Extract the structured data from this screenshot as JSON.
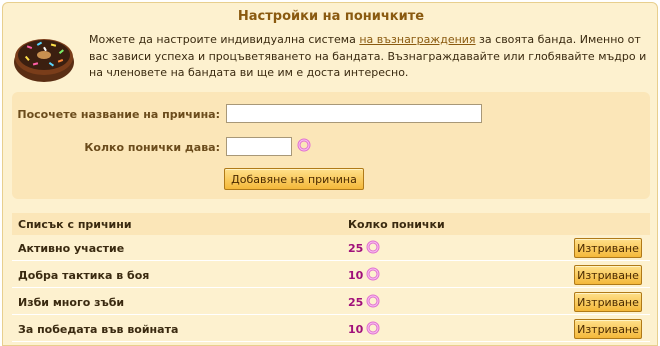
{
  "panel": {
    "title": "Настройки на поничките",
    "intro_before": "Можете да настроите индивидуална система ",
    "intro_link": "на възнаграждения",
    "intro_after": " за своята банда. Именно от вас зависи успеха и процъветяването на бандата. Възнаграждавайте или глобявайте мъдро и на членовете на бандата ви ще им е доста интересно."
  },
  "form": {
    "reason_label": "Посочете название на причина:",
    "reason_value": "",
    "donuts_label": "Колко понички дава:",
    "donuts_value": "",
    "add_button": "Добавяне на причина"
  },
  "table": {
    "col_reason": "Списък с причини",
    "col_donuts": "Колко понички",
    "delete_label": "Изтриване",
    "rows": [
      {
        "name": "Активно участие",
        "count": "25"
      },
      {
        "name": "Добра тактика в боя",
        "count": "10"
      },
      {
        "name": "Изби много зъби",
        "count": "25"
      },
      {
        "name": "За победата във войната",
        "count": "10"
      }
    ]
  },
  "colors": {
    "panel_bg": "#fdf1cf",
    "form_bg": "#fbe6b8",
    "title": "#8a5a10",
    "count": "#a0107a",
    "button": "#f4b83a"
  },
  "icons": {
    "header": "donut-icon",
    "unit": "donut-ring-icon"
  }
}
